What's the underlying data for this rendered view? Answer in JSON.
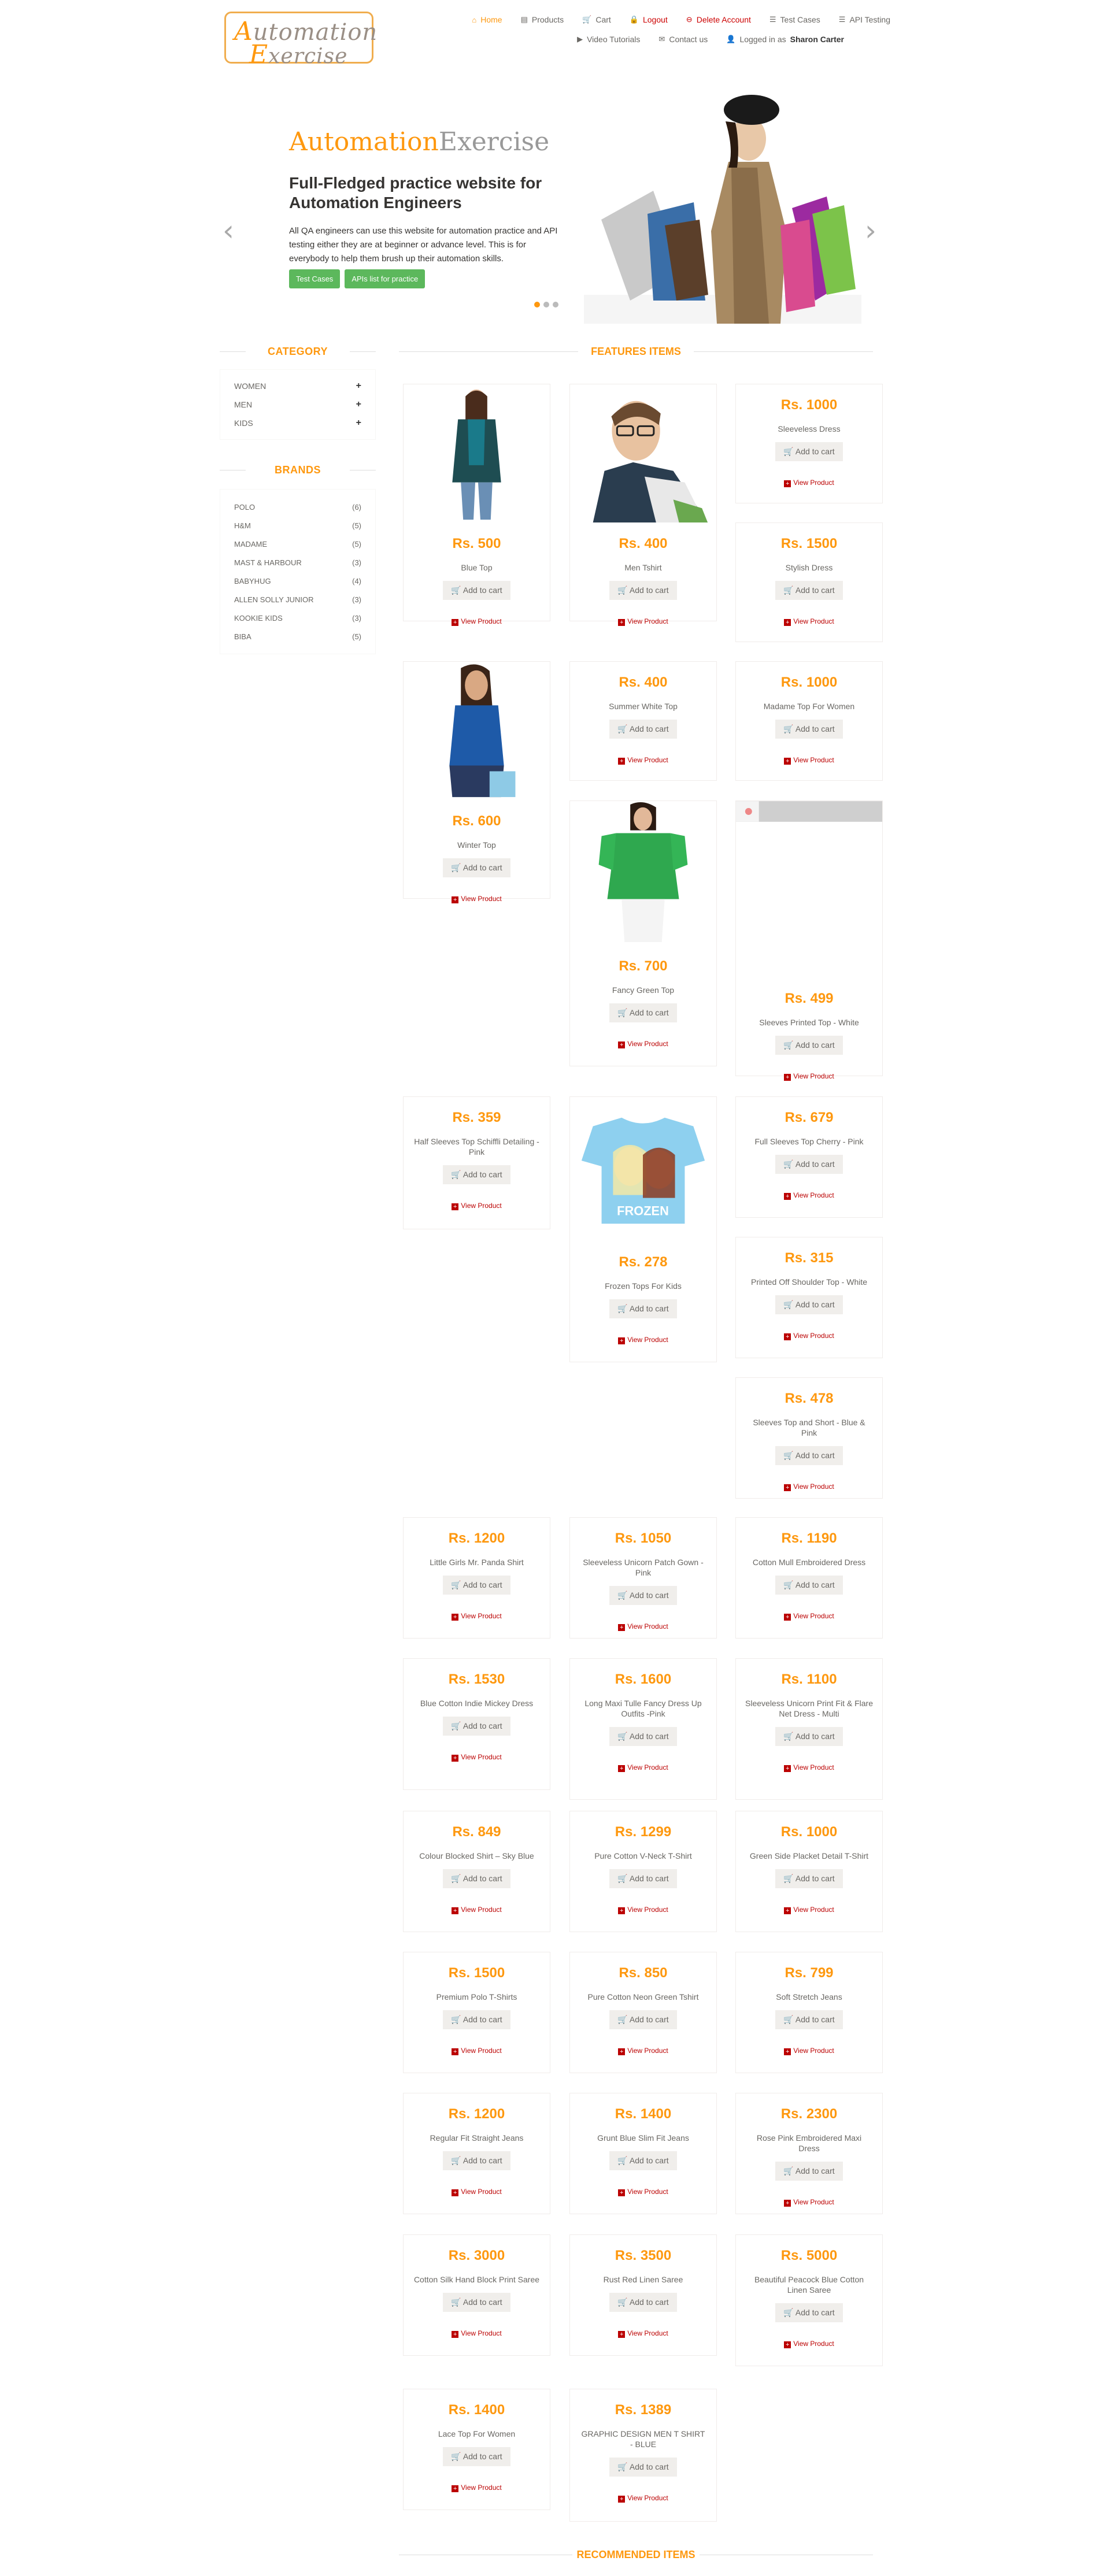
{
  "logo": {
    "word1_cap": "A",
    "word1_rest": "utomation",
    "word2_cap": "E",
    "word2_rest": "xercise"
  },
  "nav": {
    "row1": [
      {
        "icon": "home-icon",
        "glyph": "⌂",
        "label": "Home",
        "style": "active"
      },
      {
        "icon": "products-icon",
        "glyph": "▤",
        "label": "Products",
        "style": ""
      },
      {
        "icon": "cart-icon",
        "glyph": "🛒",
        "label": "Cart",
        "style": ""
      },
      {
        "icon": "lock-icon",
        "glyph": "🔒",
        "label": "Logout",
        "style": "red"
      },
      {
        "icon": "trash-icon",
        "glyph": "⊖",
        "label": "Delete Account",
        "style": "red"
      },
      {
        "icon": "list-icon",
        "glyph": "☰",
        "label": "Test Cases",
        "style": ""
      },
      {
        "icon": "list-icon",
        "glyph": "☰",
        "label": "API Testing",
        "style": ""
      }
    ],
    "row2": [
      {
        "icon": "youtube-icon",
        "glyph": "▶",
        "label": "Video Tutorials"
      },
      {
        "icon": "envelope-icon",
        "glyph": "✉",
        "label": "Contact us"
      },
      {
        "icon": "user-icon",
        "glyph": "👤",
        "label": "Logged in as"
      }
    ],
    "username": "Sharon Carter"
  },
  "slider": {
    "brand_a": "Automation",
    "brand_b": "Exercise",
    "heading": "Full-Fledged practice website for Automation Engineers",
    "text": "All QA engineers can use this website for automation practice and API testing either they are at beginner or advance level. This is for everybody to help them brush up their automation skills.",
    "btn_test_cases": "Test Cases",
    "btn_apis": "APIs list for practice"
  },
  "sidebar": {
    "category_title": "CATEGORY",
    "categories": [
      "WOMEN",
      "MEN",
      "KIDS"
    ],
    "brands_title": "BRANDS",
    "brands": [
      {
        "name": "POLO",
        "count": "(6)"
      },
      {
        "name": "H&M",
        "count": "(5)"
      },
      {
        "name": "MADAME",
        "count": "(5)"
      },
      {
        "name": "MAST & HARBOUR",
        "count": "(3)"
      },
      {
        "name": "BABYHUG",
        "count": "(4)"
      },
      {
        "name": "ALLEN SOLLY JUNIOR",
        "count": "(3)"
      },
      {
        "name": "KOOKIE KIDS",
        "count": "(3)"
      },
      {
        "name": "BIBA",
        "count": "(5)"
      }
    ]
  },
  "features_title": "FEATURES ITEMS",
  "recommended_title": "RECOMMENDED ITEMS",
  "add_label": "Add to cart",
  "view_label": "View Product",
  "products": [
    {
      "price": "Rs. 500",
      "name": "Blue Top",
      "img": "teal-cardigan"
    },
    {
      "price": "Rs. 400",
      "name": "Men Tshirt",
      "img": "man-portrait"
    },
    {
      "price": "Rs. 1000",
      "name": "Sleeveless Dress",
      "img": ""
    },
    {
      "price": "Rs. 1500",
      "name": "Stylish Dress",
      "img": ""
    },
    {
      "price": "Rs. 600",
      "name": "Winter Top",
      "img": "blue-top"
    },
    {
      "price": "Rs. 400",
      "name": "Summer White Top",
      "img": ""
    },
    {
      "price": "Rs. 1000",
      "name": "Madame Top For Women",
      "img": ""
    },
    {
      "price": "Rs. 700",
      "name": "Fancy Green Top",
      "img": "green-top"
    },
    {
      "price": "Rs. 499",
      "name": "Sleeves Printed Top - White",
      "img": "banner-strip"
    },
    {
      "price": "Rs. 359",
      "name": "Half Sleeves Top Schiffli Detailing - Pink",
      "img": ""
    },
    {
      "price": "Rs. 278",
      "name": "Frozen Tops For Kids",
      "img": "frozen-tee"
    },
    {
      "price": "Rs. 679",
      "name": "Full Sleeves Top Cherry - Pink",
      "img": ""
    },
    {
      "price": "Rs. 315",
      "name": "Printed Off Shoulder Top - White",
      "img": ""
    },
    {
      "price": "Rs. 478",
      "name": "Sleeves Top and Short - Blue & Pink",
      "img": ""
    },
    {
      "price": "Rs. 1200",
      "name": "Little Girls Mr. Panda Shirt",
      "img": ""
    },
    {
      "price": "Rs. 1050",
      "name": "Sleeveless Unicorn Patch Gown - Pink",
      "img": ""
    },
    {
      "price": "Rs. 1190",
      "name": "Cotton Mull Embroidered Dress",
      "img": ""
    },
    {
      "price": "Rs. 1530",
      "name": "Blue Cotton Indie Mickey Dress",
      "img": ""
    },
    {
      "price": "Rs. 1600",
      "name": "Long Maxi Tulle Fancy Dress Up Outfits -Pink",
      "img": ""
    },
    {
      "price": "Rs. 1100",
      "name": "Sleeveless Unicorn Print Fit & Flare Net Dress - Multi",
      "img": ""
    },
    {
      "price": "Rs. 849",
      "name": "Colour Blocked Shirt – Sky Blue",
      "img": ""
    },
    {
      "price": "Rs. 1299",
      "name": "Pure Cotton V-Neck T-Shirt",
      "img": ""
    },
    {
      "price": "Rs. 1000",
      "name": "Green Side Placket Detail T-Shirt",
      "img": ""
    },
    {
      "price": "Rs. 1500",
      "name": "Premium Polo T-Shirts",
      "img": ""
    },
    {
      "price": "Rs. 850",
      "name": "Pure Cotton Neon Green Tshirt",
      "img": ""
    },
    {
      "price": "Rs. 799",
      "name": "Soft Stretch Jeans",
      "img": ""
    },
    {
      "price": "Rs. 1200",
      "name": "Regular Fit Straight Jeans",
      "img": ""
    },
    {
      "price": "Rs. 1400",
      "name": "Grunt Blue Slim Fit Jeans",
      "img": ""
    },
    {
      "price": "Rs. 2300",
      "name": "Rose Pink Embroidered Maxi Dress",
      "img": ""
    },
    {
      "price": "Rs. 3000",
      "name": "Cotton Silk Hand Block Print Saree",
      "img": ""
    },
    {
      "price": "Rs. 3500",
      "name": "Rust Red Linen Saree",
      "img": ""
    },
    {
      "price": "Rs. 5000",
      "name": "Beautiful Peacock Blue Cotton Linen Saree",
      "img": ""
    },
    {
      "price": "Rs. 1400",
      "name": "Lace Top For Women",
      "img": ""
    },
    {
      "price": "Rs. 1389",
      "name": "GRAPHIC DESIGN MEN T SHIRT - BLUE",
      "img": ""
    }
  ]
}
